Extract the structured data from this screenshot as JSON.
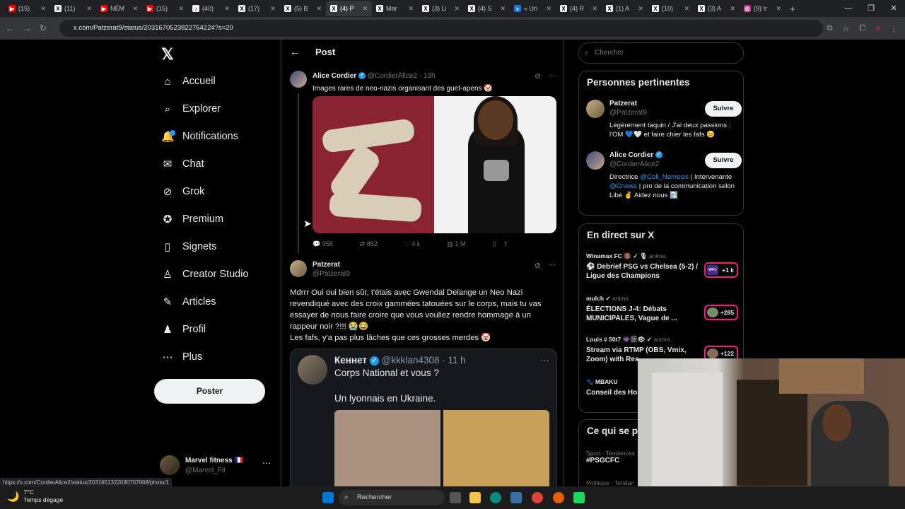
{
  "browser": {
    "tabs": [
      {
        "label": "(15)",
        "icon": "youtube-icon",
        "color": "#ff0000"
      },
      {
        "label": "(11)",
        "icon": "x-icon",
        "color": "#000000"
      },
      {
        "label": "NÉM",
        "icon": "youtube-icon",
        "color": "#ff0000"
      },
      {
        "label": "(15)",
        "icon": "youtube-icon",
        "color": "#ff0000"
      },
      {
        "label": "(40)",
        "icon": "tiktok-icon",
        "color": "#000000"
      },
      {
        "label": "(17)",
        "icon": "x-icon",
        "color": "#000000"
      },
      {
        "label": "(5) B",
        "icon": "x-icon",
        "color": "#000000"
      },
      {
        "label": "(4) P",
        "icon": "x-icon",
        "color": "#000000",
        "active": true
      },
      {
        "label": "Mar",
        "icon": "x-icon",
        "color": "#000000"
      },
      {
        "label": "(3) Li",
        "icon": "x-icon",
        "color": "#000000"
      },
      {
        "label": "(4) S",
        "icon": "x-icon",
        "color": "#000000"
      },
      {
        "label": "« Un",
        "icon": "blue-doc-icon",
        "color": "#1a73e8"
      },
      {
        "label": "(4) R",
        "icon": "x-icon",
        "color": "#000000"
      },
      {
        "label": "(1) A",
        "icon": "x-icon",
        "color": "#000000"
      },
      {
        "label": "(10)",
        "icon": "x-icon",
        "color": "#000000"
      },
      {
        "label": "(3) A",
        "icon": "x-icon",
        "color": "#000000"
      },
      {
        "label": "(9) Ir",
        "icon": "instagram-icon",
        "color": "#c13584"
      }
    ],
    "url": "x.com/Patzerat9/status/2031670523822764224?s=20",
    "status_url": "https://x.com/CordierAlice2/status/2031651322030707008/photo/1"
  },
  "nav": {
    "items": [
      "Accueil",
      "Explorer",
      "Notifications",
      "Chat",
      "Grok",
      "Premium",
      "Signets",
      "Creator Studio",
      "Articles",
      "Profil",
      "Plus"
    ],
    "post_button": "Poster",
    "account_name": "Marvel fitness 🇫🇷",
    "account_handle": "@Marvel_Fit"
  },
  "column": {
    "title": "Post",
    "tweet1": {
      "name": "Alice Cordier",
      "handle": "@CordierAlice2 · 13h",
      "text": "Images rares de neo-nazis organisant des guet-apens 🤡",
      "replies": "958",
      "reposts": "852",
      "likes": "4 k",
      "views": "1 M"
    },
    "tweet2": {
      "name": "Patzerat",
      "handle": "@Patzerat9",
      "text": "Mdrrr Oui oui bien sûr, t'étais avec Gwendal Delange un Neo Nazi revendiqué avec des croix gammées tatouées sur le corps, mais tu vas essayer de nous faire croire que vous vouliez rendre hommage à un rappeur noir ?!!! 😭😂",
      "text2": "Les fafs, y'a pas plus lâches que ces grosses merdes 🤡"
    },
    "quote": {
      "name": "Кеннет",
      "handle": "@kkklan4308 · 11 h",
      "line1": "Corps National et vous ?",
      "line2": "Un lyonnais en Ukraine."
    }
  },
  "sidebar": {
    "search_placeholder": "Chercher",
    "relevant_title": "Personnes pertinentes",
    "people": [
      {
        "name": "Patzerat",
        "handle": "@Patzerat9",
        "bio": "Légèrement taquin / J'ai deux passions : l'OM 💙🤍 et faire chier les fafs 😊",
        "follow": "Suivre"
      },
      {
        "name": "Alice Cordier",
        "handle": "@CordierAlice2",
        "bio_pre": "Directrice ",
        "bio_link1": "@Coll_Nemesis",
        "bio_mid": " | Intervenante ",
        "bio_link2": "@Cnews",
        "bio_post": " | pro de la communication selon Libé ✌️ Aidez nous ⤵️",
        "follow": "Suivre"
      }
    ],
    "live_title": "En direct sur X",
    "live": [
      {
        "host": "Winamax FC 🔞 ✓ 🎙",
        "state": "anime.",
        "title": "⚽ Debrief PSG vs Chelsea (5-2) / Ligue des Champions",
        "count": "+1 k"
      },
      {
        "host": "mulch ✓",
        "state": "anime.",
        "title": "ÉLECTIONS J-4: Débats MUNICIPALES, Vague de ...",
        "count": "+285"
      },
      {
        "host": "Louis # 50t7 👾🎬👁 ✓",
        "state": "anime.",
        "title": "Stream via RTMP (OBS, Vmix, Zoom) with Res",
        "count": "+122"
      },
      {
        "host": "🐾 MBAKU",
        "state": "",
        "title": "Conseil des Ho",
        "count": ""
      }
    ],
    "trends_title": "Ce qui se p",
    "trends": [
      {
        "cat": "Sport · Tendances",
        "tag": "#PSGCFC"
      },
      {
        "cat": "Politique · Tendan",
        "tag": ""
      }
    ]
  },
  "taskbar": {
    "temp": "7°C",
    "weather": "Temps dégagé",
    "search": "Rechercher"
  }
}
